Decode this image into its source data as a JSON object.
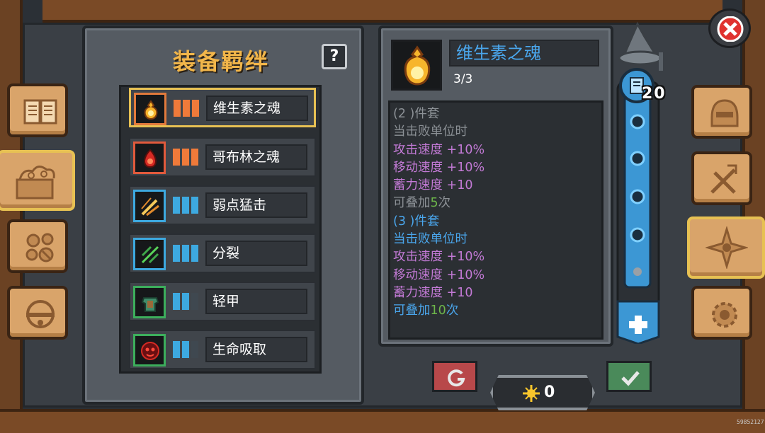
{
  "panel": {
    "title": "装备羁绊",
    "help_label": "?"
  },
  "bonds": [
    {
      "name": "维生素之魂",
      "icon": "golden-soul-icon",
      "tier_color": "#ef7a3a",
      "selected": true
    },
    {
      "name": "哥布林之魂",
      "icon": "red-soul-icon",
      "tier_color": "#ef7a3a",
      "selected": false
    },
    {
      "name": "弱点猛击",
      "icon": "weak-strike-icon",
      "tier_color": "#3da9e0",
      "selected": false
    },
    {
      "name": "分裂",
      "icon": "split-arrows-icon",
      "tier_color": "#3da9e0",
      "selected": false
    },
    {
      "name": "轻甲",
      "icon": "light-armor-icon",
      "tier_color": "#3da9e0",
      "selected": false
    },
    {
      "name": "生命吸取",
      "icon": "life-steal-icon",
      "tier_color": "#3da9e0",
      "selected": false
    }
  ],
  "detail": {
    "name": "维生素之魂",
    "count": "3/3",
    "set2": {
      "header": "(2 )件套",
      "trigger": "当击败单位时",
      "effects": [
        "攻击速度 +10%",
        "移动速度 +10%",
        "蓄力速度 +10"
      ],
      "stack_prefix": "可叠加",
      "stack_num": "5",
      "stack_suffix": "次"
    },
    "set3": {
      "header": "(3 )件套",
      "trigger": "当击败单位时",
      "effects": [
        "攻击速度 +10%",
        "移动速度 +10%",
        "蓄力速度 +10"
      ],
      "stack_prefix": "可叠加",
      "stack_num": "10",
      "stack_suffix": "次"
    }
  },
  "level": {
    "value": "20"
  },
  "currency": {
    "value": "0"
  },
  "watermark": "59852127",
  "colors": {
    "accent_gold": "#f2b64a",
    "highlight_border": "#e7c153",
    "blue_text": "#4aa6ec",
    "purple_text": "#c37ad6",
    "green_text": "#6db64a",
    "close_red": "#e0322f"
  },
  "side_tabs_left": [
    "book-icon",
    "cloud-chest-icon",
    "beast-tracks-icon",
    "helm-wheel-icon"
  ],
  "side_tabs_right": [
    "helmet-icon",
    "skill-upgrade-icon",
    "bond-compass-icon",
    "gear-settings-icon"
  ]
}
